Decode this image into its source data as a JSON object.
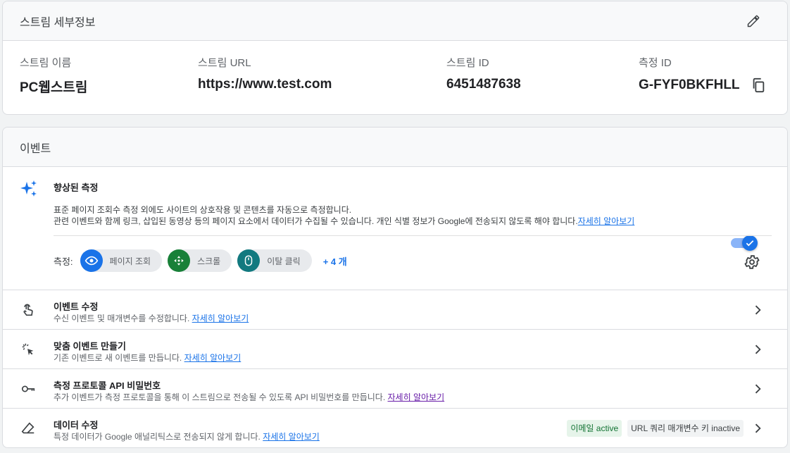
{
  "stream": {
    "title": "스트림 세부정보",
    "fields": [
      {
        "label": "스트림 이름",
        "value": "PC웹스트림"
      },
      {
        "label": "스트림 URL",
        "value": "https://www.test.com"
      },
      {
        "label": "스트림 ID",
        "value": "6451487638"
      },
      {
        "label": "측정 ID",
        "value": "G-FYF0BKFHLL"
      }
    ]
  },
  "events": {
    "title": "이벤트",
    "enhanced": {
      "title": "향상된 측정",
      "desc_line1": "표준 페이지 조회수 측정 외에도 사이트의 상호작용 및 콘텐츠를 자동으로 측정합니다.",
      "desc_line2": "관련 이벤트와 함께 링크, 삽입된 동영상 등의 페이지 요소에서 데이터가 수집될 수 있습니다. 개인 식별 정보가 Google에 전송되지 않도록 해야 합니다.",
      "learn_more": "자세히 알아보기",
      "toggle_on": true,
      "measure_label": "측정:",
      "chips": [
        {
          "label": "페이지 조회",
          "icon": "eye-icon",
          "color": "#1a73e8"
        },
        {
          "label": "스크롤",
          "icon": "scroll-arrows-icon",
          "color": "#188038"
        },
        {
          "label": "이탈 클릭",
          "icon": "mouse-icon",
          "color": "#12797f"
        }
      ],
      "more": "+ 4 개"
    },
    "rows": [
      {
        "title": "이벤트 수정",
        "desc": "수신 이벤트 및 매개변수를 수정합니다.",
        "link": "자세히 알아보기",
        "icon": "touch-icon"
      },
      {
        "title": "맞춤 이벤트 만들기",
        "desc": "기존 이벤트로 새 이벤트를 만듭니다.",
        "link": "자세히 알아보기",
        "icon": "click-sparkle-icon"
      },
      {
        "title": "측정 프로토콜 API 비밀번호",
        "desc": "추가 이벤트가 측정 프로토콜을 통해 이 스트림으로 전송될 수 있도록 API 비밀번호를 만듭니다.",
        "link": "자세히 알아보기",
        "icon": "key-icon"
      },
      {
        "title": "데이터 수정",
        "desc": "특정 데이터가 Google 애널리틱스로 전송되지 않게 합니다.",
        "link": "자세히 알아보기",
        "icon": "eraser-icon",
        "badges": [
          {
            "label": "이메일 active",
            "state": "active"
          },
          {
            "label": "URL 쿼리 매개변수 키 inactive",
            "state": "inactive"
          }
        ]
      }
    ]
  }
}
